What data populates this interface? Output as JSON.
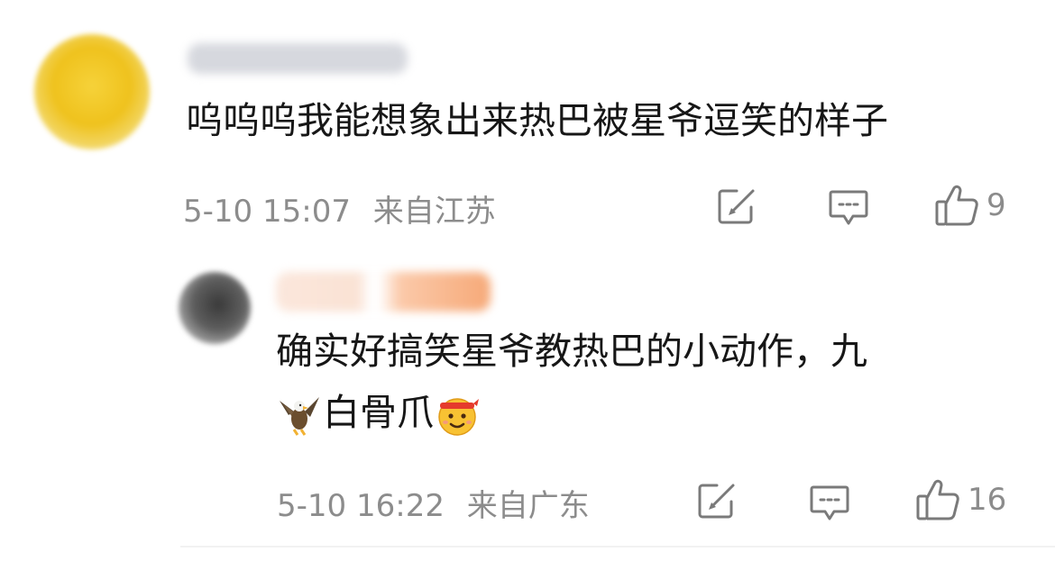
{
  "comments": [
    {
      "content": "呜呜呜我能想象出来热巴被星爷逗笑的样子",
      "time": "5-10 15:07",
      "location": "来自江苏",
      "likes": "9"
    },
    {
      "content_line1": "确实好搞笑星爷教热巴的小动作，九",
      "content_line2": "白骨爪",
      "time": "5-10 16:22",
      "location": "来自广东",
      "likes": "16"
    }
  ],
  "icons": {
    "share": "share-icon",
    "reply": "comment-icon",
    "like": "thumbs-up-icon",
    "eagle": "eagle-emoji",
    "struggle": "fighting-emoji"
  },
  "colors": {
    "text": "#171717",
    "meta": "#8c8c8c",
    "icon": "#7a7a7a"
  }
}
